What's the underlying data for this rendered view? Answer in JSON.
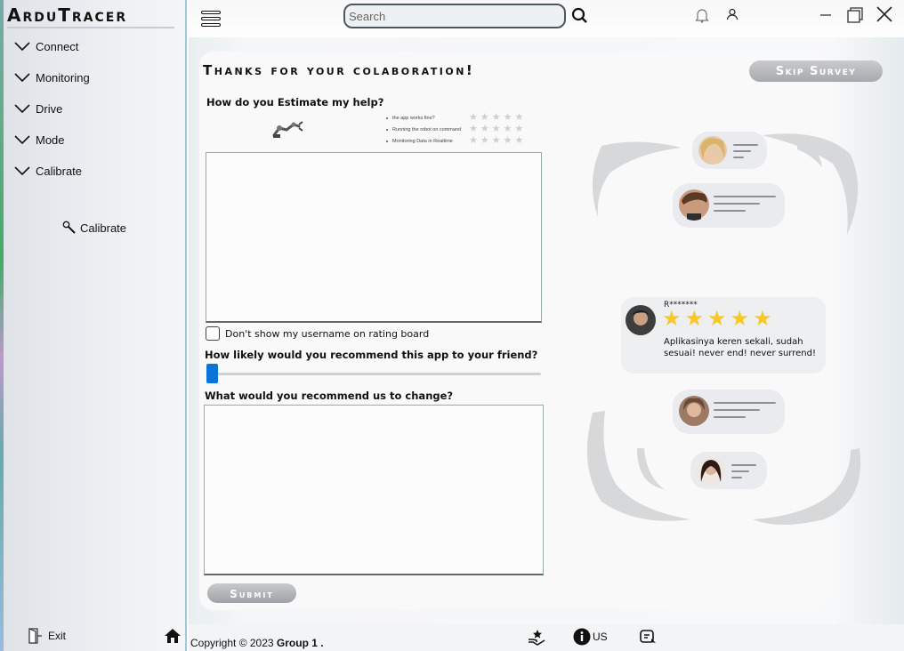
{
  "app": {
    "title": "ArduTracer"
  },
  "sidebar": {
    "items": [
      {
        "label": "Connect",
        "icon": "chevron-down-icon"
      },
      {
        "label": "Monitoring",
        "icon": "chevron-down-icon"
      },
      {
        "label": "Drive",
        "icon": "chevron-down-icon"
      },
      {
        "label": "Mode",
        "icon": "chevron-down-icon"
      },
      {
        "label": "Calibrate",
        "icon": "chevron-down-icon"
      }
    ],
    "sub_item": {
      "label": "Calibrate",
      "icon": "wrench-icon"
    },
    "exit_label": "Exit"
  },
  "topbar": {
    "search_placeholder": "Search"
  },
  "survey": {
    "title": "Thanks for your colaboration!",
    "skip_label": "Skip Survey",
    "q1": "How do you Estimate my help?",
    "ratings": [
      {
        "label": "the app works fine?",
        "stars": 0
      },
      {
        "label": "Running the robot on command",
        "stars": 0
      },
      {
        "label": "Monitoring Data in Realtime",
        "stars": 0
      }
    ],
    "checkbox_label": "Don't show my username on rating board",
    "q2": "How likely would you recommend this app to your friend?",
    "slider_value": 0,
    "q3": "What  would you recommend us to change?",
    "submit_label": "Submit"
  },
  "illustration": {
    "review_name": "R*******",
    "review_stars": "★★★★★",
    "review_rating": 4.5,
    "review_text": "Aplikasinya keren sekali, sudah sesuai! never end! never surrend!"
  },
  "footer": {
    "copyright_prefix": "Copyright © 2023 ",
    "copyright_group": "Group 1 .",
    "about_label": "US"
  },
  "colors": {
    "accent": "#0a74d8",
    "star": "#f7c928",
    "sidebar_border": "#9fc7d8"
  }
}
